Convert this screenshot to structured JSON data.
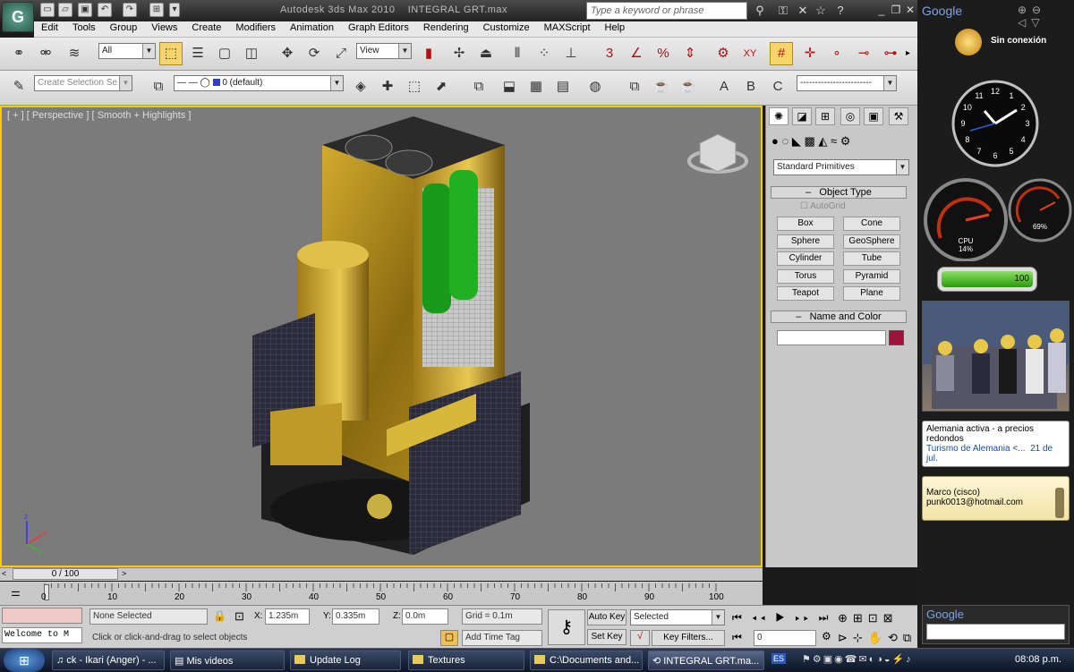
{
  "title_bar": {
    "app_title": "Autodesk 3ds Max  2010",
    "file_title": "INTEGRAL GRT.max",
    "search_placeholder": "Type a keyword or phrase"
  },
  "menu": [
    "Edit",
    "Tools",
    "Group",
    "Views",
    "Create",
    "Modifiers",
    "Animation",
    "Graph Editors",
    "Rendering",
    "Customize",
    "MAXScript",
    "Help"
  ],
  "main_toolbar": {
    "selection_filter": "All",
    "reference_coord": "View"
  },
  "layer_toolbar": {
    "named_selection_placeholder": "Create Selection Se",
    "layer": "0 (default)",
    "snap_labels": [
      "3",
      "%",
      "XY",
      "A",
      "B",
      "C"
    ]
  },
  "viewport": {
    "label": "[ + ] [ Perspective ] [ Smooth + Highlights ]",
    "axis_x": "x",
    "axis_y": "y",
    "axis_z": "z"
  },
  "command_panel": {
    "category": "Standard Primitives",
    "object_type_header": "Object Type",
    "autogrid_label": "AutoGrid",
    "buttons": [
      "Box",
      "Cone",
      "Sphere",
      "GeoSphere",
      "Cylinder",
      "Tube",
      "Torus",
      "Pyramid",
      "Teapot",
      "Plane"
    ],
    "name_color_header": "Name and Color",
    "name_value": "",
    "object_color": "#a0103a"
  },
  "time": {
    "slider_label": "0 / 100",
    "ticks": [
      "0",
      "10",
      "20",
      "30",
      "40",
      "50",
      "60",
      "70",
      "80",
      "90",
      "100"
    ]
  },
  "status_bar": {
    "selection": "None Selected",
    "x_label": "X:",
    "x_value": "1.235m",
    "y_label": "Y:",
    "y_value": "0.335m",
    "z_label": "Z:",
    "z_value": "0.0m",
    "grid": "Grid = 0.1m",
    "prompt": "Click or click-and-drag to select objects",
    "add_time_tag": "Add Time Tag",
    "maxscript_listener": "Welcome to M",
    "auto_key": "Auto Key",
    "set_key": "Set Key",
    "key_mode": "Selected",
    "key_filters": "Key Filters...",
    "frame": "0"
  },
  "sidebar": {
    "brand": "Google",
    "weather": "Sin conexión",
    "clock_numbers": [
      "12",
      "1",
      "2",
      "3",
      "4",
      "5",
      "6",
      "7",
      "8",
      "9",
      "10",
      "11"
    ],
    "cpu_label": "CPU",
    "cpu_value": "14%",
    "mem_value": "69%",
    "battery_value": "100",
    "news_headline": "Alemania activa - a precios redondos",
    "news_source": "Turismo de Alemania <...",
    "news_date": "21 de jul.",
    "contact_name": "Marco (cisco)",
    "contact_email": "punk0013@hotmail.com",
    "search_brand": "Google"
  },
  "taskbar": {
    "items": [
      "ck - Ikari (Anger) - ...",
      "Mis videos",
      "Update Log",
      "Textures",
      "C:\\Documents and...",
      "INTEGRAL GRT.ma..."
    ],
    "lang": "ES",
    "time": "08:08 p.m."
  }
}
